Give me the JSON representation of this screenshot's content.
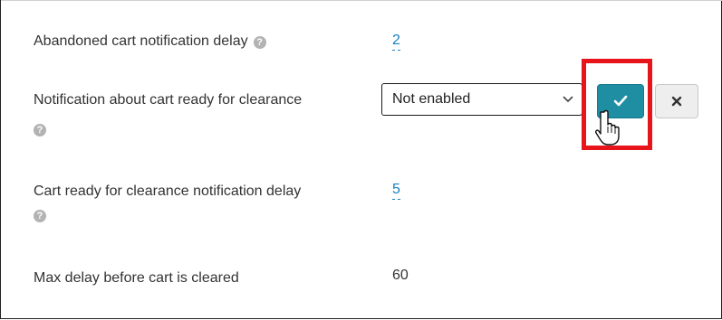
{
  "settings": {
    "abandoned_delay": {
      "label": "Abandoned cart notification delay",
      "value": "2",
      "help_icon": "question-circle-icon"
    },
    "ready_notification": {
      "label": "Notification about cart ready for clearance",
      "selected": "Not enabled",
      "help_icon": "question-circle-icon"
    },
    "ready_delay": {
      "label": "Cart ready for clearance notification delay",
      "value": "5",
      "help_icon": "question-circle-icon"
    },
    "max_delay": {
      "label": "Max delay before cart is cleared",
      "value": "60"
    }
  },
  "controls": {
    "confirm_icon": "checkmark-icon",
    "cancel_icon": "close-icon",
    "accent_color": "#1f8ea3",
    "highlight_color": "#e8141c"
  },
  "help_glyph": "?"
}
